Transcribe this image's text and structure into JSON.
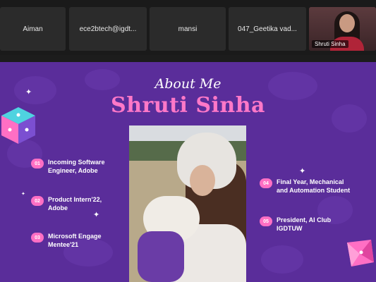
{
  "participants": [
    {
      "name": "Aiman"
    },
    {
      "name": "ece2btech@igdt..."
    },
    {
      "name": "mansi"
    },
    {
      "name": "047_Geetika vad..."
    }
  ],
  "active_video": {
    "name": "Shruti Sinha"
  },
  "slide": {
    "heading": "About Me",
    "name": "Shruti Sinha",
    "points": [
      {
        "num": "01",
        "line1": "Incoming Software",
        "line2": "Engineer, Adobe"
      },
      {
        "num": "02",
        "line1": "Product Intern'22,",
        "line2": "Adobe"
      },
      {
        "num": "03",
        "line1": "Microsoft Engage",
        "line2": "Mentee'21"
      },
      {
        "num": "04",
        "line1": "Final Year, Mechanical",
        "line2": "and Automation Student"
      },
      {
        "num": "05",
        "line1": "President, AI Club",
        "line2": "IGDTUW"
      }
    ]
  },
  "colors": {
    "slide_bg": "#5a2d9a",
    "accent_pink": "#ff6fc4",
    "name_pink": "#ff78c8"
  }
}
